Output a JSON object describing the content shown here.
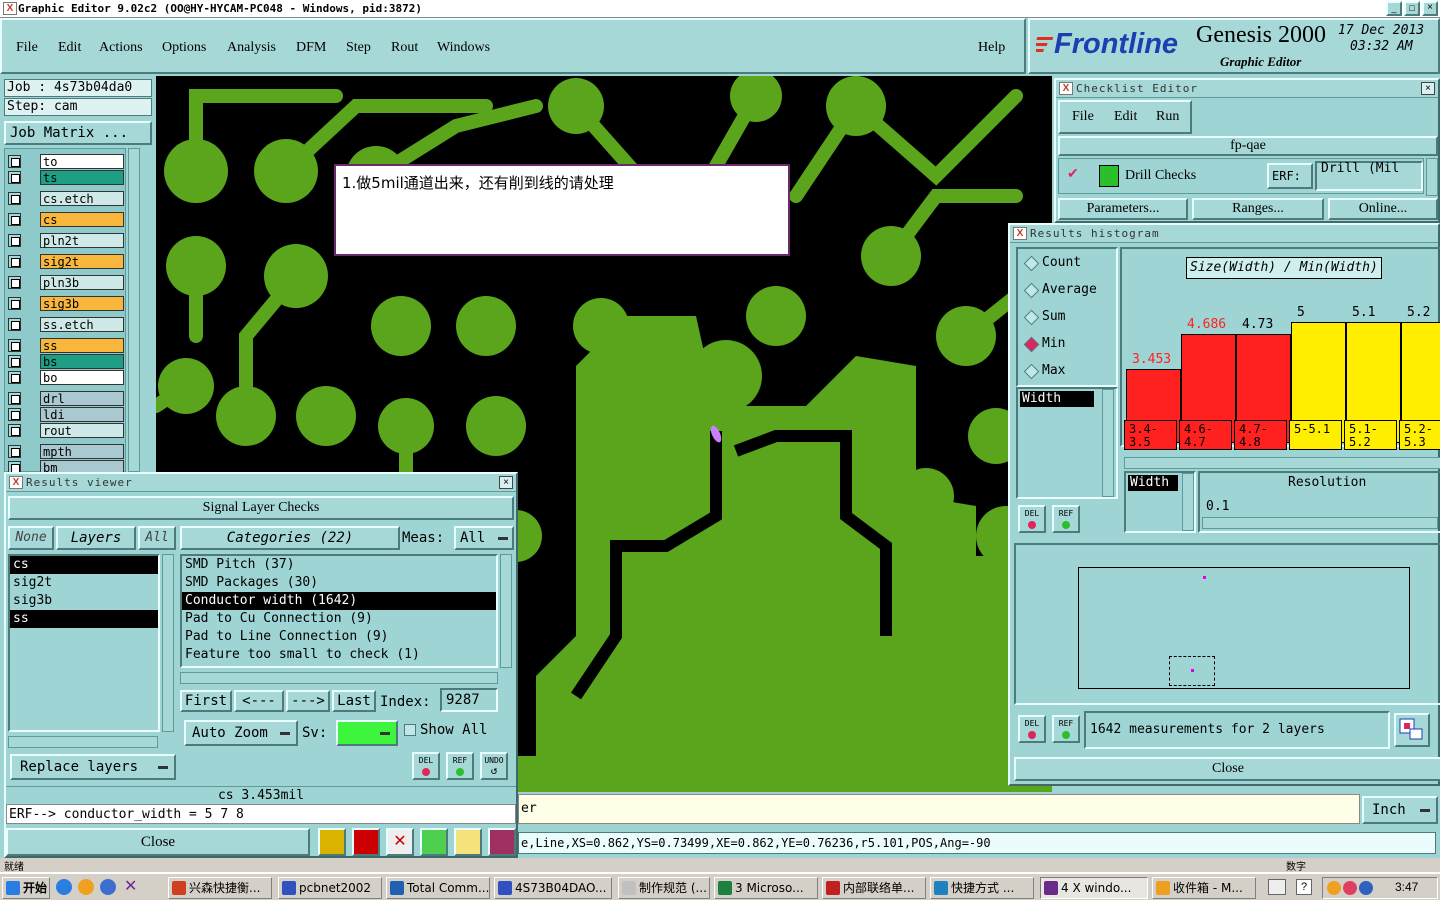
{
  "titlebar": {
    "title": "Graphic Editor 9.02c2 (OO@HY-HYCAM-PC048 - Windows, pid:3872)"
  },
  "menu": {
    "items": [
      "File",
      "Edit",
      "Actions",
      "Options",
      "Analysis",
      "DFM",
      "Step",
      "Rout",
      "Windows"
    ],
    "help": "Help"
  },
  "brand": {
    "logo": "Frontline",
    "product": "Genesis 2000",
    "subtitle": "Graphic Editor",
    "date": "17 Dec 2013",
    "time": "03:32 AM"
  },
  "job": {
    "job": "Job : 4s73b04da0",
    "step": "Step: cam",
    "matrix": "Job Matrix ..."
  },
  "layers": [
    {
      "name": "to",
      "color": "#ffffff"
    },
    {
      "name": "ts",
      "color": "#1f9e86"
    },
    {
      "name": "cs.etch",
      "color": "#cfe9e9"
    },
    {
      "name": "cs",
      "color": "#f8b73c"
    },
    {
      "name": "pln2t",
      "color": "#cfe9e9"
    },
    {
      "name": "sig2t",
      "color": "#f8b73c"
    },
    {
      "name": "pln3b",
      "color": "#cfe9e9"
    },
    {
      "name": "sig3b",
      "color": "#f8b73c"
    },
    {
      "name": "ss.etch",
      "color": "#cfe9e9"
    },
    {
      "name": "ss",
      "color": "#f8b73c"
    },
    {
      "name": "bs",
      "color": "#1f9e86"
    },
    {
      "name": "bo",
      "color": "#ffffff"
    },
    {
      "name": "drl",
      "color": "#a9c8d2"
    },
    {
      "name": "ldi",
      "color": "#a9c8d2"
    },
    {
      "name": "rout",
      "color": "#cfe9e9"
    },
    {
      "name": "mpth",
      "color": "#a9c8d2"
    },
    {
      "name": "bm",
      "color": "#a9c8d2"
    }
  ],
  "note": {
    "text": "1.做5mil通道出来，还有削到线的请处理"
  },
  "checklist": {
    "title": "Checklist Editor",
    "menu": [
      "File",
      "Edit",
      "Run"
    ],
    "name": "fp-qae",
    "row": {
      "label": "Drill Checks",
      "erf_label": "ERF:",
      "erf_value": "Drill (Mil"
    },
    "buttons": [
      "Parameters...",
      "Ranges...",
      "Online..."
    ]
  },
  "histogram": {
    "title": "Results histogram",
    "modes": [
      "Count",
      "Average",
      "Sum",
      "Min",
      "Max"
    ],
    "selected_mode": "Min",
    "header": "Size(Width) / Min(Width)",
    "attr": "Width",
    "attr2": "Width",
    "resolution_label": "Resolution",
    "resolution_value": "0.1",
    "bars": [
      {
        "value": "3.453",
        "range": "3.4-3.5",
        "level": 0.38,
        "color": "#ff2020",
        "text_color": "#ff2020"
      },
      {
        "value": "4.686",
        "range": "4.6-4.7",
        "level": 0.56,
        "color": "#ff2020",
        "text_color": "#ff2020"
      },
      {
        "value": "4.73",
        "range": "4.7-4.8",
        "level": 0.56,
        "color": "#ff2020",
        "text_color": "#000000"
      },
      {
        "value": "5",
        "range": "5-5.1",
        "level": 0.62,
        "color": "#ffee00",
        "text_color": "#000000"
      },
      {
        "value": "5.1",
        "range": "5.1-5.2",
        "level": 0.62,
        "color": "#ffee00",
        "text_color": "#000000"
      },
      {
        "value": "5.2",
        "range": "5.2-5.3",
        "level": 0.62,
        "color": "#ffee00",
        "text_color": "#000000"
      }
    ],
    "status": "1642 measurements for 2 layers",
    "close": "Close",
    "btn_del": "DEL",
    "btn_ref": "REF"
  },
  "results": {
    "title": "Results viewer",
    "section": "Signal Layer Checks",
    "none": "None",
    "layers_label": "Layers",
    "all": "All",
    "categories_label": "Categories (22)",
    "meas_label": "Meas:",
    "meas_value": "All",
    "layer_list": [
      {
        "name": "cs",
        "sel": true
      },
      {
        "name": "sig2t",
        "sel": false
      },
      {
        "name": "sig3b",
        "sel": false
      },
      {
        "name": "ss",
        "sel": true
      }
    ],
    "categories": [
      {
        "name": "SMD Pitch (37)",
        "sel": false
      },
      {
        "name": "SMD Packages (30)",
        "sel": false
      },
      {
        "name": "Conductor width (1642)",
        "sel": true
      },
      {
        "name": "Pad to Cu Connection (9)",
        "sel": false
      },
      {
        "name": "Pad to Line Connection (9)",
        "sel": false
      },
      {
        "name": "Feature too small to check (1)",
        "sel": false
      }
    ],
    "nav": {
      "first": "First",
      "prev": "<---",
      "next": "--->",
      "last": "Last",
      "index_label": "Index:",
      "index_value": "9287"
    },
    "autozoom": "Auto Zoom",
    "sv_label": "Sv:",
    "show_all": "Show All",
    "replace": "Replace layers",
    "status": "cs 3.453mil",
    "erf": "ERF--> conductor_width = 5 7 8",
    "close": "Close",
    "btn_del": "DEL",
    "btn_ref": "REF",
    "btn_undo": "UNDO"
  },
  "bottom": {
    "msg": "er",
    "units": "Inch",
    "feature": "e,Line,XS=0.862,YS=0.73499,XE=0.862,YE=0.76236,r5.101,POS,Ang=-90"
  },
  "taskbar": {
    "start": "开始",
    "tasks": [
      "兴森快捷衡...",
      "pcbnet2002",
      "Total Comm...",
      "4S73B04DAO...",
      "制作规范 (...",
      "3 Microso...",
      "内部联络单...",
      "快捷方式 ...",
      "4 X windo...",
      "收件箱 - M..."
    ],
    "clock": "3:47",
    "ime": "就绪",
    "num": "数字"
  }
}
